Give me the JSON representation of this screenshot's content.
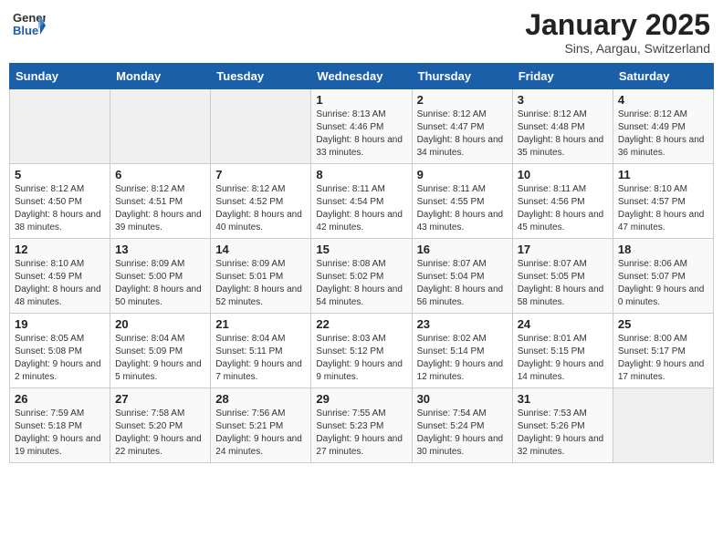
{
  "logo": {
    "general": "General",
    "blue": "Blue"
  },
  "title": "January 2025",
  "subtitle": "Sins, Aargau, Switzerland",
  "weekdays": [
    "Sunday",
    "Monday",
    "Tuesday",
    "Wednesday",
    "Thursday",
    "Friday",
    "Saturday"
  ],
  "weeks": [
    [
      {
        "day": null,
        "info": null
      },
      {
        "day": null,
        "info": null
      },
      {
        "day": null,
        "info": null
      },
      {
        "day": "1",
        "info": "Sunrise: 8:13 AM\nSunset: 4:46 PM\nDaylight: 8 hours\nand 33 minutes."
      },
      {
        "day": "2",
        "info": "Sunrise: 8:12 AM\nSunset: 4:47 PM\nDaylight: 8 hours\nand 34 minutes."
      },
      {
        "day": "3",
        "info": "Sunrise: 8:12 AM\nSunset: 4:48 PM\nDaylight: 8 hours\nand 35 minutes."
      },
      {
        "day": "4",
        "info": "Sunrise: 8:12 AM\nSunset: 4:49 PM\nDaylight: 8 hours\nand 36 minutes."
      }
    ],
    [
      {
        "day": "5",
        "info": "Sunrise: 8:12 AM\nSunset: 4:50 PM\nDaylight: 8 hours\nand 38 minutes."
      },
      {
        "day": "6",
        "info": "Sunrise: 8:12 AM\nSunset: 4:51 PM\nDaylight: 8 hours\nand 39 minutes."
      },
      {
        "day": "7",
        "info": "Sunrise: 8:12 AM\nSunset: 4:52 PM\nDaylight: 8 hours\nand 40 minutes."
      },
      {
        "day": "8",
        "info": "Sunrise: 8:11 AM\nSunset: 4:54 PM\nDaylight: 8 hours\nand 42 minutes."
      },
      {
        "day": "9",
        "info": "Sunrise: 8:11 AM\nSunset: 4:55 PM\nDaylight: 8 hours\nand 43 minutes."
      },
      {
        "day": "10",
        "info": "Sunrise: 8:11 AM\nSunset: 4:56 PM\nDaylight: 8 hours\nand 45 minutes."
      },
      {
        "day": "11",
        "info": "Sunrise: 8:10 AM\nSunset: 4:57 PM\nDaylight: 8 hours\nand 47 minutes."
      }
    ],
    [
      {
        "day": "12",
        "info": "Sunrise: 8:10 AM\nSunset: 4:59 PM\nDaylight: 8 hours\nand 48 minutes."
      },
      {
        "day": "13",
        "info": "Sunrise: 8:09 AM\nSunset: 5:00 PM\nDaylight: 8 hours\nand 50 minutes."
      },
      {
        "day": "14",
        "info": "Sunrise: 8:09 AM\nSunset: 5:01 PM\nDaylight: 8 hours\nand 52 minutes."
      },
      {
        "day": "15",
        "info": "Sunrise: 8:08 AM\nSunset: 5:02 PM\nDaylight: 8 hours\nand 54 minutes."
      },
      {
        "day": "16",
        "info": "Sunrise: 8:07 AM\nSunset: 5:04 PM\nDaylight: 8 hours\nand 56 minutes."
      },
      {
        "day": "17",
        "info": "Sunrise: 8:07 AM\nSunset: 5:05 PM\nDaylight: 8 hours\nand 58 minutes."
      },
      {
        "day": "18",
        "info": "Sunrise: 8:06 AM\nSunset: 5:07 PM\nDaylight: 9 hours\nand 0 minutes."
      }
    ],
    [
      {
        "day": "19",
        "info": "Sunrise: 8:05 AM\nSunset: 5:08 PM\nDaylight: 9 hours\nand 2 minutes."
      },
      {
        "day": "20",
        "info": "Sunrise: 8:04 AM\nSunset: 5:09 PM\nDaylight: 9 hours\nand 5 minutes."
      },
      {
        "day": "21",
        "info": "Sunrise: 8:04 AM\nSunset: 5:11 PM\nDaylight: 9 hours\nand 7 minutes."
      },
      {
        "day": "22",
        "info": "Sunrise: 8:03 AM\nSunset: 5:12 PM\nDaylight: 9 hours\nand 9 minutes."
      },
      {
        "day": "23",
        "info": "Sunrise: 8:02 AM\nSunset: 5:14 PM\nDaylight: 9 hours\nand 12 minutes."
      },
      {
        "day": "24",
        "info": "Sunrise: 8:01 AM\nSunset: 5:15 PM\nDaylight: 9 hours\nand 14 minutes."
      },
      {
        "day": "25",
        "info": "Sunrise: 8:00 AM\nSunset: 5:17 PM\nDaylight: 9 hours\nand 17 minutes."
      }
    ],
    [
      {
        "day": "26",
        "info": "Sunrise: 7:59 AM\nSunset: 5:18 PM\nDaylight: 9 hours\nand 19 minutes."
      },
      {
        "day": "27",
        "info": "Sunrise: 7:58 AM\nSunset: 5:20 PM\nDaylight: 9 hours\nand 22 minutes."
      },
      {
        "day": "28",
        "info": "Sunrise: 7:56 AM\nSunset: 5:21 PM\nDaylight: 9 hours\nand 24 minutes."
      },
      {
        "day": "29",
        "info": "Sunrise: 7:55 AM\nSunset: 5:23 PM\nDaylight: 9 hours\nand 27 minutes."
      },
      {
        "day": "30",
        "info": "Sunrise: 7:54 AM\nSunset: 5:24 PM\nDaylight: 9 hours\nand 30 minutes."
      },
      {
        "day": "31",
        "info": "Sunrise: 7:53 AM\nSunset: 5:26 PM\nDaylight: 9 hours\nand 32 minutes."
      },
      {
        "day": null,
        "info": null
      }
    ]
  ]
}
